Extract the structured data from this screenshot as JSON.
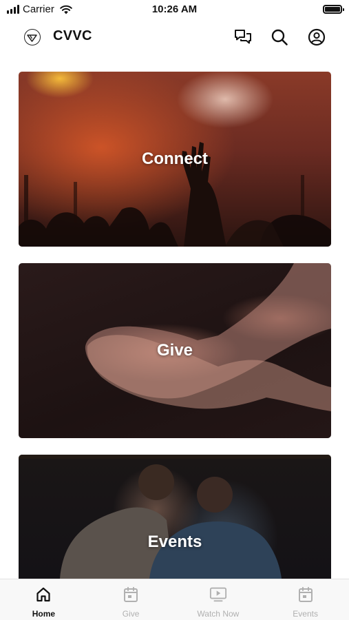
{
  "status_bar": {
    "carrier": "Carrier",
    "time": "10:26 AM"
  },
  "header": {
    "title": "CVVC",
    "icons": [
      "logo-icon",
      "chat-icon",
      "search-icon",
      "profile-icon"
    ]
  },
  "cards": [
    {
      "label": "Connect"
    },
    {
      "label": "Give"
    },
    {
      "label": "Events"
    }
  ],
  "tabs": [
    {
      "label": "Home",
      "icon": "home-icon",
      "active": true
    },
    {
      "label": "Give",
      "icon": "calendar-icon",
      "active": false
    },
    {
      "label": "Watch Now",
      "icon": "play-screen-icon",
      "active": false
    },
    {
      "label": "Events",
      "icon": "calendar-icon",
      "active": false
    }
  ],
  "colors": {
    "active_tab": "#111111",
    "inactive_tab": "#b0b0b0",
    "tab_bar_bg": "#f8f8f8"
  }
}
